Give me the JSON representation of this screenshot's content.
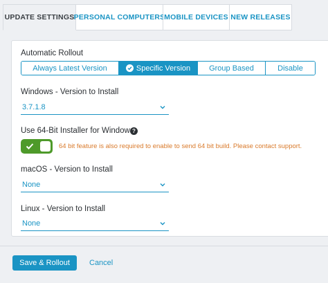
{
  "tabs": [
    {
      "label": "UPDATE SETTINGS",
      "active": true
    },
    {
      "label": "PERSONAL COMPUTERS",
      "active": false
    },
    {
      "label": "MOBILE DEVICES",
      "active": false
    },
    {
      "label": "NEW RELEASES",
      "active": false
    }
  ],
  "rollout": {
    "label": "Automatic Rollout",
    "options": [
      "Always Latest Version",
      "Specific Version",
      "Group Based",
      "Disable"
    ],
    "selected": "Specific Version"
  },
  "windows": {
    "label": "Windows - Version to Install",
    "value": "3.7.1.8"
  },
  "installer64": {
    "label": "Use 64-Bit Installer for Windows",
    "enabled": true,
    "warning": "64 bit feature is also required to enable to send 64 bit build. Please contact support."
  },
  "macos": {
    "label": "macOS - Version to Install",
    "value": "None"
  },
  "linux": {
    "label": "Linux - Version to Install",
    "value": "None"
  },
  "actions": {
    "save_label": "Save & Rollout",
    "cancel_label": "Cancel"
  },
  "colors": {
    "accent": "#1a94c4",
    "toggle_on": "#4e9a2a",
    "warning": "#d97a2b"
  }
}
